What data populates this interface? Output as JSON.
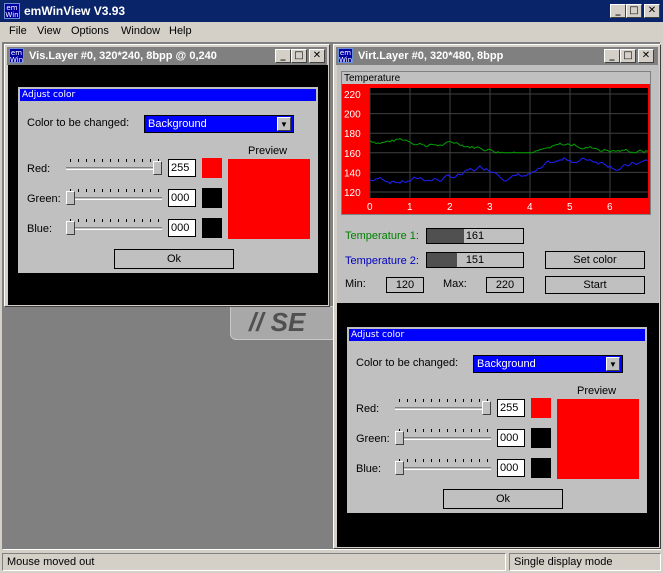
{
  "app": {
    "icon_text": "em Win",
    "title": "emWinView V3.93",
    "minimize": "_",
    "maximize": "□",
    "close": "✕"
  },
  "menu": {
    "items": [
      {
        "label": "File"
      },
      {
        "label": "View"
      },
      {
        "label": "Options"
      },
      {
        "label": "Window"
      },
      {
        "label": "Help"
      }
    ]
  },
  "logo_text": "// SE",
  "vis_window": {
    "title": "Vis.Layer #0, 320*240, 8bpp @ 0,240",
    "dialog": {
      "title": "Adjust color",
      "color_label": "Color to be changed:",
      "dropdown_value": "Background",
      "preview_label": "Preview",
      "rows": [
        {
          "label": "Red:",
          "value": "255",
          "level": 1.0,
          "swatch": "#ff0000"
        },
        {
          "label": "Green:",
          "value": "000",
          "level": 0.0,
          "swatch": "#000000"
        },
        {
          "label": "Blue:",
          "value": "000",
          "level": 0.0,
          "swatch": "#000000"
        }
      ],
      "preview_color": "#ff0000",
      "ok_label": "Ok"
    }
  },
  "virt_window": {
    "title": "Virt.Layer #0, 320*480, 8bpp",
    "graph": {
      "title": "Temperature",
      "background": "#ff0000",
      "plot_background": "#000000",
      "y_ticks": [
        "220",
        "200",
        "180",
        "160",
        "140",
        "120"
      ],
      "x_ticks": [
        "0",
        "1",
        "2",
        "3",
        "4",
        "5",
        "6"
      ]
    },
    "temp1_label": "Temperature 1:",
    "temp1_value": "161",
    "temp1_level": 0.39,
    "temp1_color": "#008000",
    "temp2_label": "Temperature 2:",
    "temp2_value": "151",
    "temp2_level": 0.31,
    "temp2_color": "#0000c0",
    "min_label": "Min:",
    "min_value": "120",
    "max_label": "Max:",
    "max_value": "220",
    "set_color_label": "Set color",
    "start_label": "Start",
    "dialog": {
      "title": "Adjust color",
      "color_label": "Color to be changed:",
      "dropdown_value": "Background",
      "preview_label": "Preview",
      "rows": [
        {
          "label": "Red:",
          "value": "255",
          "level": 1.0,
          "swatch": "#ff0000"
        },
        {
          "label": "Green:",
          "value": "000",
          "level": 0.0,
          "swatch": "#000000"
        },
        {
          "label": "Blue:",
          "value": "000",
          "level": 0.0,
          "swatch": "#000000"
        }
      ],
      "preview_color": "#ff0000",
      "ok_label": "Ok"
    }
  },
  "status": {
    "left": "Mouse moved out",
    "right": "Single display mode"
  },
  "colors": {
    "title_active": "#0a246a",
    "dialog_title": "#0000ff",
    "grid": "#404040"
  }
}
